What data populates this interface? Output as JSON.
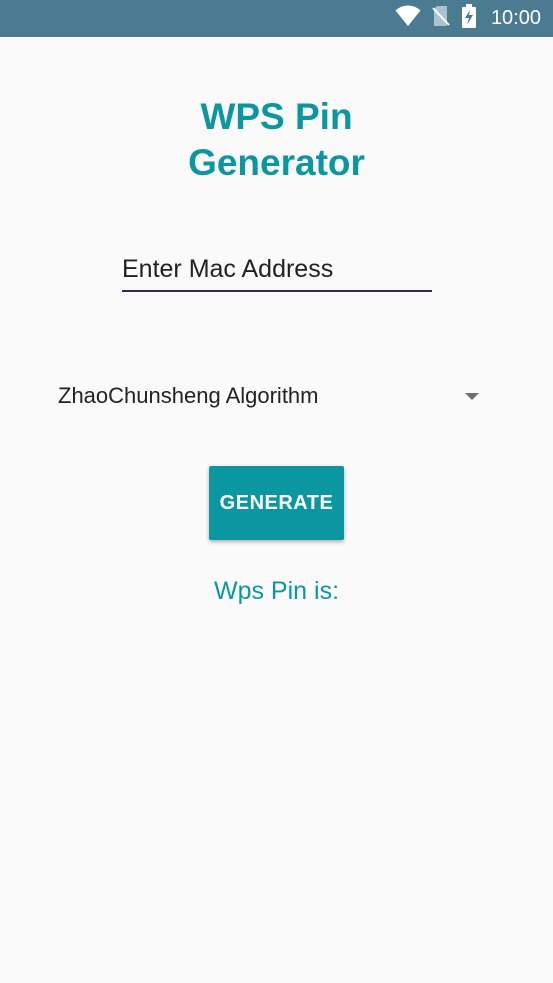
{
  "status_bar": {
    "time": "10:00",
    "icons": [
      "wifi-icon",
      "no-sim-icon",
      "battery-charging-icon"
    ],
    "background": "#4b7b91"
  },
  "app": {
    "title_line1": "WPS Pin",
    "title_line2": "Generator",
    "accent_color": "#0b97a1"
  },
  "mac_input": {
    "placeholder": "Enter Mac Address",
    "value": ""
  },
  "algorithm_select": {
    "selected": "ZhaoChunsheng Algorithm"
  },
  "generate_button": {
    "label": "GENERATE"
  },
  "result": {
    "label": "Wps Pin is:"
  }
}
